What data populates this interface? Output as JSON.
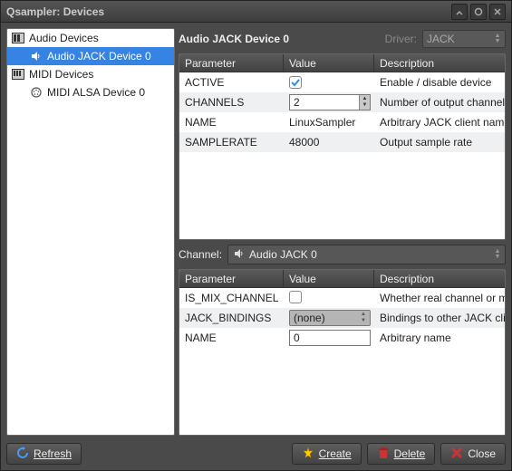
{
  "title": "Qsampler: Devices",
  "tree": {
    "audio_root": "Audio Devices",
    "audio_child": "Audio JACK Device 0",
    "midi_root": "MIDI Devices",
    "midi_child": "MIDI ALSA Device 0"
  },
  "header": {
    "device_title": "Audio JACK Device 0",
    "driver_label": "Driver:",
    "driver_value": "JACK"
  },
  "table_headers": {
    "param": "Parameter",
    "value": "Value",
    "desc": "Description"
  },
  "device_params": [
    {
      "name": "ACTIVE",
      "type": "check",
      "value": true,
      "desc": "Enable / disable device"
    },
    {
      "name": "CHANNELS",
      "type": "spin",
      "value": "2",
      "desc": "Number of output channels"
    },
    {
      "name": "NAME",
      "type": "text_plain",
      "value": "LinuxSampler",
      "desc": "Arbitrary JACK client name"
    },
    {
      "name": "SAMPLERATE",
      "type": "text_plain",
      "value": "48000",
      "desc": "Output sample rate"
    }
  ],
  "channel": {
    "label": "Channel:",
    "value": "Audio JACK 0"
  },
  "channel_params": [
    {
      "name": "IS_MIX_CHANNEL",
      "type": "check",
      "value": false,
      "desc": "Whether real channel or mix"
    },
    {
      "name": "JACK_BINDINGS",
      "type": "combo",
      "value": "(none)",
      "desc": "Bindings to other JACK clients"
    },
    {
      "name": "NAME",
      "type": "input",
      "value": "0",
      "desc": "Arbitrary name"
    }
  ],
  "buttons": {
    "refresh": "Refresh",
    "create": "Create",
    "delete": "Delete",
    "close": "Close"
  }
}
